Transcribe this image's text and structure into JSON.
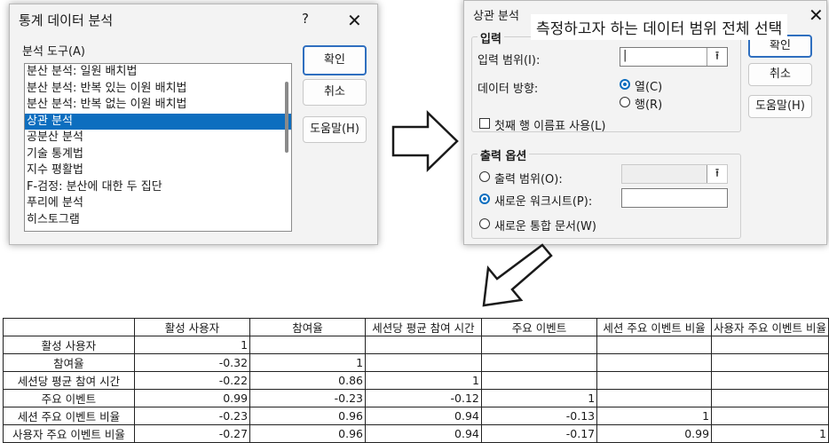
{
  "dialog1": {
    "title": "통계 데이터 분석",
    "help_glyph": "?",
    "close_glyph": "✕",
    "tools_label": "분석 도구(A)",
    "items": [
      "분산 분석: 일원 배치법",
      "분산 분석: 반복 있는 이원 배치법",
      "분산 분석: 반복 없는 이원 배치법",
      "상관 분석",
      "공분산 분석",
      "기술 통계법",
      "지수 평활법",
      "F-검정: 분산에 대한 두 집단",
      "푸리에 분석",
      "히스토그램"
    ],
    "selected_index": 3,
    "buttons": {
      "ok": "확인",
      "cancel": "취소",
      "help": "도움말(H)"
    }
  },
  "dialog2": {
    "title": "상관 분석",
    "caption": "측정하고자 하는 데이터 범위 전체 선택",
    "close_glyph": "✕",
    "input_group": "입력",
    "input_range_label": "입력 범위(I):",
    "input_range_value": "|",
    "range_button_glyph": "⭱",
    "direction_label": "데이터 방향:",
    "direction_options": [
      "열(C)",
      "행(R)"
    ],
    "direction_selected": 0,
    "first_row_label": "첫째 행 이름표 사용(L)",
    "output_group": "출력 옵션",
    "output_options": [
      "출력 범위(O):",
      "새로운 워크시트(P):",
      "새로운 통합 문서(W)"
    ],
    "output_selected": 1,
    "buttons": {
      "ok": "확인",
      "cancel": "취소",
      "help": "도움말(H)"
    }
  },
  "table": {
    "headers": [
      "",
      "활성 사용자",
      "참여율",
      "세션당 평균 참여 시간",
      "주요 이벤트",
      "세션 주요 이벤트 비율",
      "사용자 주요 이벤트 비율"
    ],
    "rows": [
      {
        "label": "활성 사용자",
        "values": [
          "1",
          "",
          "",
          "",
          "",
          ""
        ]
      },
      {
        "label": "참여율",
        "values": [
          "-0.32",
          "1",
          "",
          "",
          "",
          ""
        ]
      },
      {
        "label": "세션당 평균 참여 시간",
        "values": [
          "-0.22",
          "0.86",
          "1",
          "",
          "",
          ""
        ]
      },
      {
        "label": "주요 이벤트",
        "values": [
          "0.99",
          "-0.23",
          "-0.12",
          "1",
          "",
          ""
        ]
      },
      {
        "label": "세션 주요 이벤트 비율",
        "values": [
          "-0.23",
          "0.96",
          "0.94",
          "-0.13",
          "1",
          ""
        ]
      },
      {
        "label": "사용자 주요 이벤트 비율",
        "values": [
          "-0.27",
          "0.96",
          "0.94",
          "-0.17",
          "0.99",
          "1"
        ]
      }
    ]
  }
}
